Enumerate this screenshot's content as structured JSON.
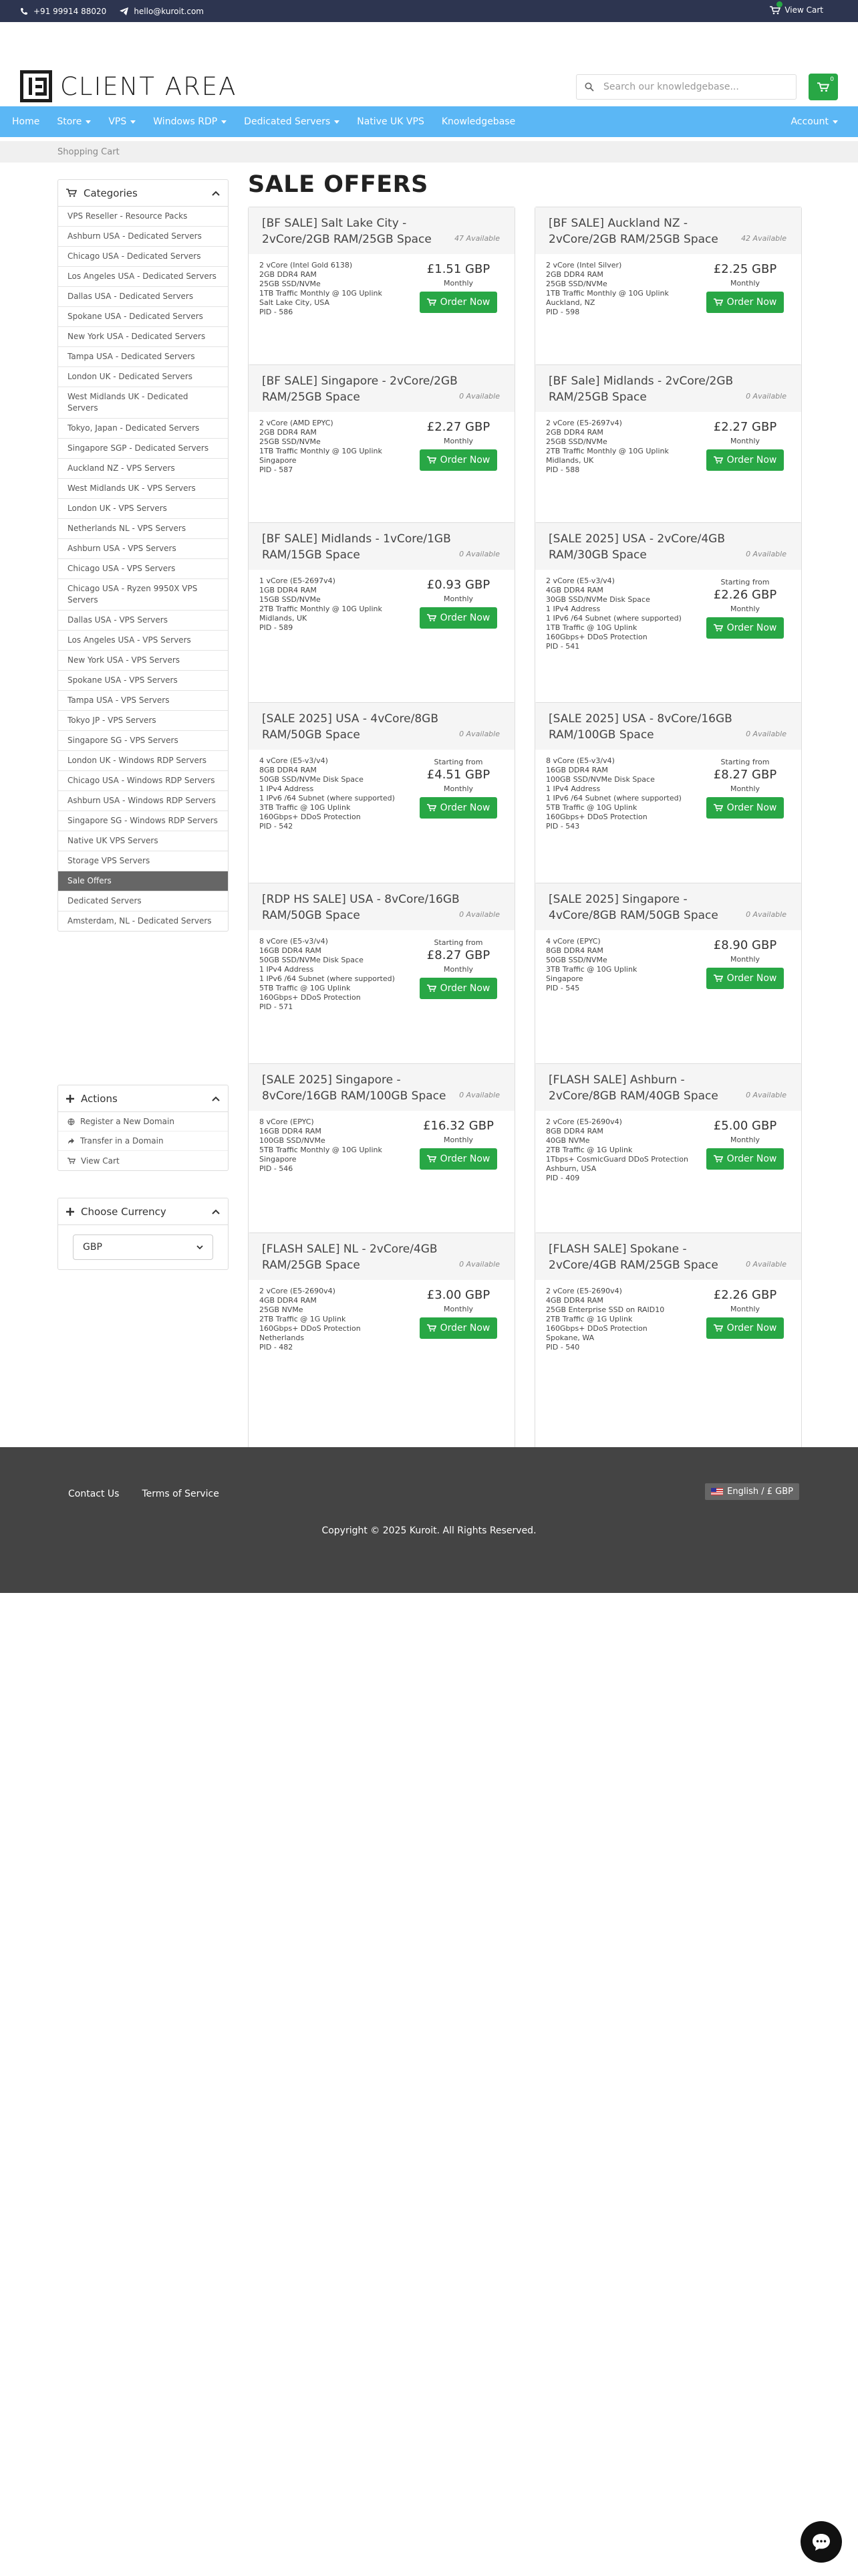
{
  "topbar": {
    "phone": "+91 99914 88020",
    "email": "hello@kuroit.com",
    "cart_label": "View Cart"
  },
  "brand": {
    "name": "CLIENT AREA"
  },
  "search": {
    "placeholder": "Search our knowledgebase..."
  },
  "cart_count": "0",
  "nav": {
    "items": [
      "Home",
      "Store",
      "VPS",
      "Windows RDP",
      "Dedicated Servers",
      "Native UK VPS",
      "Knowledgebase"
    ],
    "account": "Account"
  },
  "breadcrumb": "Shopping Cart",
  "sidebar": {
    "categories_title": "Categories",
    "categories": [
      "VPS Reseller - Resource Packs",
      "Ashburn USA - Dedicated Servers",
      "Chicago USA - Dedicated Servers",
      "Los Angeles USA - Dedicated Servers",
      "Dallas USA - Dedicated Servers",
      "Spokane USA - Dedicated Servers",
      "New York USA - Dedicated Servers",
      "Tampa USA - Dedicated Servers",
      "London UK - Dedicated Servers",
      "West Midlands UK - Dedicated Servers",
      "Tokyo, Japan - Dedicated Servers",
      "Singapore SGP - Dedicated Servers",
      "Auckland NZ - VPS Servers",
      "West Midlands UK - VPS Servers",
      "London UK - VPS Servers",
      "Netherlands NL - VPS Servers",
      "Ashburn USA - VPS Servers",
      "Chicago USA - VPS Servers",
      "Chicago USA - Ryzen 9950X VPS Servers",
      "Dallas USA - VPS Servers",
      "Los Angeles USA - VPS Servers",
      "New York USA - VPS Servers",
      "Spokane USA - VPS Servers",
      "Tampa USA - VPS Servers",
      "Tokyo JP - VPS Servers",
      "Singapore SG - VPS Servers",
      "London UK - Windows RDP Servers",
      "Chicago USA - Windows RDP Servers",
      "Ashburn USA - Windows RDP Servers",
      "Singapore SG - Windows RDP Servers",
      "Native UK VPS Servers",
      "Storage VPS Servers",
      "Sale Offers",
      "Dedicated Servers",
      "Amsterdam, NL - Dedicated Servers"
    ],
    "active": "Sale Offers",
    "actions_title": "Actions",
    "actions": [
      "Register a New Domain",
      "Transfer in a Domain",
      "View Cart"
    ],
    "currency_title": "Choose Currency",
    "currency": "GBP"
  },
  "page_title": "SALE OFFERS",
  "products": [
    {
      "name": "[BF SALE] Salt Lake City - 2vCore/2GB RAM/25GB Space",
      "avail": "47 Available",
      "desc": "2 vCore (Intel Gold 6138)\n2GB DDR4 RAM\n25GB SSD/NVMe\n1TB Traffic Monthly @ 10G Uplink\nSalt Lake City, USA\nPID - 586",
      "starting": "",
      "price": "£1.51 GBP",
      "cycle": "Monthly",
      "btn": "Order Now"
    },
    {
      "name": "[BF SALE] Auckland NZ - 2vCore/2GB RAM/25GB Space",
      "avail": "42 Available",
      "desc": "2 vCore (Intel Silver)\n2GB DDR4 RAM\n25GB SSD/NVMe\n1TB Traffic Monthly @ 10G Uplink\nAuckland, NZ\nPID - 598",
      "starting": "",
      "price": "£2.25 GBP",
      "cycle": "Monthly",
      "btn": "Order Now"
    },
    {
      "name": "[BF SALE] Singapore - 2vCore/2GB RAM/25GB Space",
      "avail": "0 Available",
      "desc": "2 vCore (AMD EPYC)\n2GB DDR4 RAM\n25GB SSD/NVMe\n1TB Traffic Monthly @ 10G Uplink\nSingapore\nPID - 587",
      "starting": "",
      "price": "£2.27 GBP",
      "cycle": "Monthly",
      "btn": "Order Now"
    },
    {
      "name": "[BF Sale] Midlands - 2vCore/2GB RAM/25GB Space",
      "avail": "0 Available",
      "desc": "2 vCore (E5-2697v4)\n2GB DDR4 RAM\n25GB SSD/NVMe\n2TB Traffic Monthly @ 10G Uplink\nMidlands, UK\nPID - 588",
      "starting": "",
      "price": "£2.27 GBP",
      "cycle": "Monthly",
      "btn": "Order Now"
    },
    {
      "name": "[BF SALE] Midlands - 1vCore/1GB RAM/15GB Space",
      "avail": "0 Available",
      "desc": "1 vCore (E5-2697v4)\n1GB DDR4 RAM\n15GB SSD/NVMe\n2TB Traffic Monthly @ 10G Uplink\nMidlands, UK\nPID - 589",
      "starting": "",
      "price": "£0.93 GBP",
      "cycle": "Monthly",
      "btn": "Order Now"
    },
    {
      "name": "[SALE 2025] USA - 2vCore/4GB RAM/30GB Space",
      "avail": "0 Available",
      "desc": "2 vCore (E5-v3/v4)\n4GB DDR4 RAM\n30GB SSD/NVMe Disk Space\n1 IPv4 Address\n1 IPv6 /64 Subnet (where supported)\n1TB Traffic @ 10G Uplink\n160Gbps+ DDoS Protection\nPID - 541",
      "starting": "Starting from",
      "price": "£2.26 GBP",
      "cycle": "Monthly",
      "btn": "Order Now"
    },
    {
      "name": "[SALE 2025] USA - 4vCore/8GB RAM/50GB Space",
      "avail": "0 Available",
      "desc": "4 vCore (E5-v3/v4)\n8GB DDR4 RAM\n50GB SSD/NVMe Disk Space\n1 IPv4 Address\n1 IPv6 /64 Subnet (where supported)\n3TB Traffic @ 10G Uplink\n160Gbps+ DDoS Protection\nPID - 542",
      "starting": "Starting from",
      "price": "£4.51 GBP",
      "cycle": "Monthly",
      "btn": "Order Now"
    },
    {
      "name": "[SALE 2025] USA - 8vCore/16GB RAM/100GB Space",
      "avail": "0 Available",
      "desc": "8 vCore (E5-v3/v4)\n16GB DDR4 RAM\n100GB SSD/NVMe Disk Space\n1 IPv4 Address\n1 IPv6 /64 Subnet (where supported)\n5TB Traffic @ 10G Uplink\n160Gbps+ DDoS Protection\nPID - 543",
      "starting": "Starting from",
      "price": "£8.27 GBP",
      "cycle": "Monthly",
      "btn": "Order Now"
    },
    {
      "name": "[RDP HS SALE] USA - 8vCore/16GB RAM/50GB Space",
      "avail": "0 Available",
      "desc": "8 vCore (E5-v3/v4)\n16GB DDR4 RAM\n50GB SSD/NVMe Disk Space\n1 IPv4 Address\n1 IPv6 /64 Subnet (where supported)\n5TB Traffic @ 10G Uplink\n160Gbps+ DDoS Protection\nPID - 571",
      "starting": "Starting from",
      "price": "£8.27 GBP",
      "cycle": "Monthly",
      "btn": "Order Now"
    },
    {
      "name": "[SALE 2025] Singapore - 4vCore/8GB RAM/50GB Space",
      "avail": "0 Available",
      "desc": "4 vCore (EPYC)\n8GB DDR4 RAM\n50GB SSD/NVMe\n3TB Traffic @ 10G Uplink\nSingapore\nPID - 545",
      "starting": "",
      "price": "£8.90 GBP",
      "cycle": "Monthly",
      "btn": "Order Now"
    },
    {
      "name": "[SALE 2025] Singapore - 8vCore/16GB RAM/100GB Space",
      "avail": "0 Available",
      "desc": "8 vCore (EPYC)\n16GB DDR4 RAM\n100GB SSD/NVMe\n5TB Traffic Monthly @ 10G Uplink\nSingapore\nPID - 546",
      "starting": "",
      "price": "£16.32 GBP",
      "cycle": "Monthly",
      "btn": "Order Now"
    },
    {
      "name": "[FLASH SALE] Ashburn - 2vCore/8GB RAM/40GB Space",
      "avail": "0 Available",
      "desc": "2 vCore (E5-2690v4)\n8GB DDR4 RAM\n40GB NVMe\n2TB Traffic @ 1G Uplink\n1Tbps+ CosmicGuard DDoS Protection\nAshburn, USA\nPID - 409",
      "starting": "",
      "price": "£5.00 GBP",
      "cycle": "Monthly",
      "btn": "Order Now"
    },
    {
      "name": "[FLASH SALE] NL - 2vCore/4GB RAM/25GB Space",
      "avail": "0 Available",
      "desc": "2 vCore (E5-2690v4)\n4GB DDR4 RAM\n25GB NVMe\n2TB Traffic @ 1G Uplink\n160Gbps+ DDoS Protection\nNetherlands\nPID - 482",
      "starting": "",
      "price": "£3.00 GBP",
      "cycle": "Monthly",
      "btn": "Order Now"
    },
    {
      "name": "[FLASH SALE] Spokane - 2vCore/4GB RAM/25GB Space",
      "avail": "0 Available",
      "desc": "2 vCore (E5-2690v4)\n4GB DDR4 RAM\n25GB Enterprise SSD on RAID10\n2TB Traffic @ 1G Uplink\n160Gbps+ DDoS Protection\nSpokane, WA\nPID - 540",
      "starting": "",
      "price": "£2.26 GBP",
      "cycle": "Monthly",
      "btn": "Order Now"
    }
  ],
  "footer": {
    "links": [
      "Contact Us",
      "Terms of Service"
    ],
    "language": "English / £ GBP",
    "copyright": "Copyright © 2025 Kuroit. All Rights Reserved."
  },
  "colors": {
    "topbar": "#2d3550",
    "nav": "#5bb7f5",
    "accent_green": "#28a745",
    "footer": "#444444"
  }
}
